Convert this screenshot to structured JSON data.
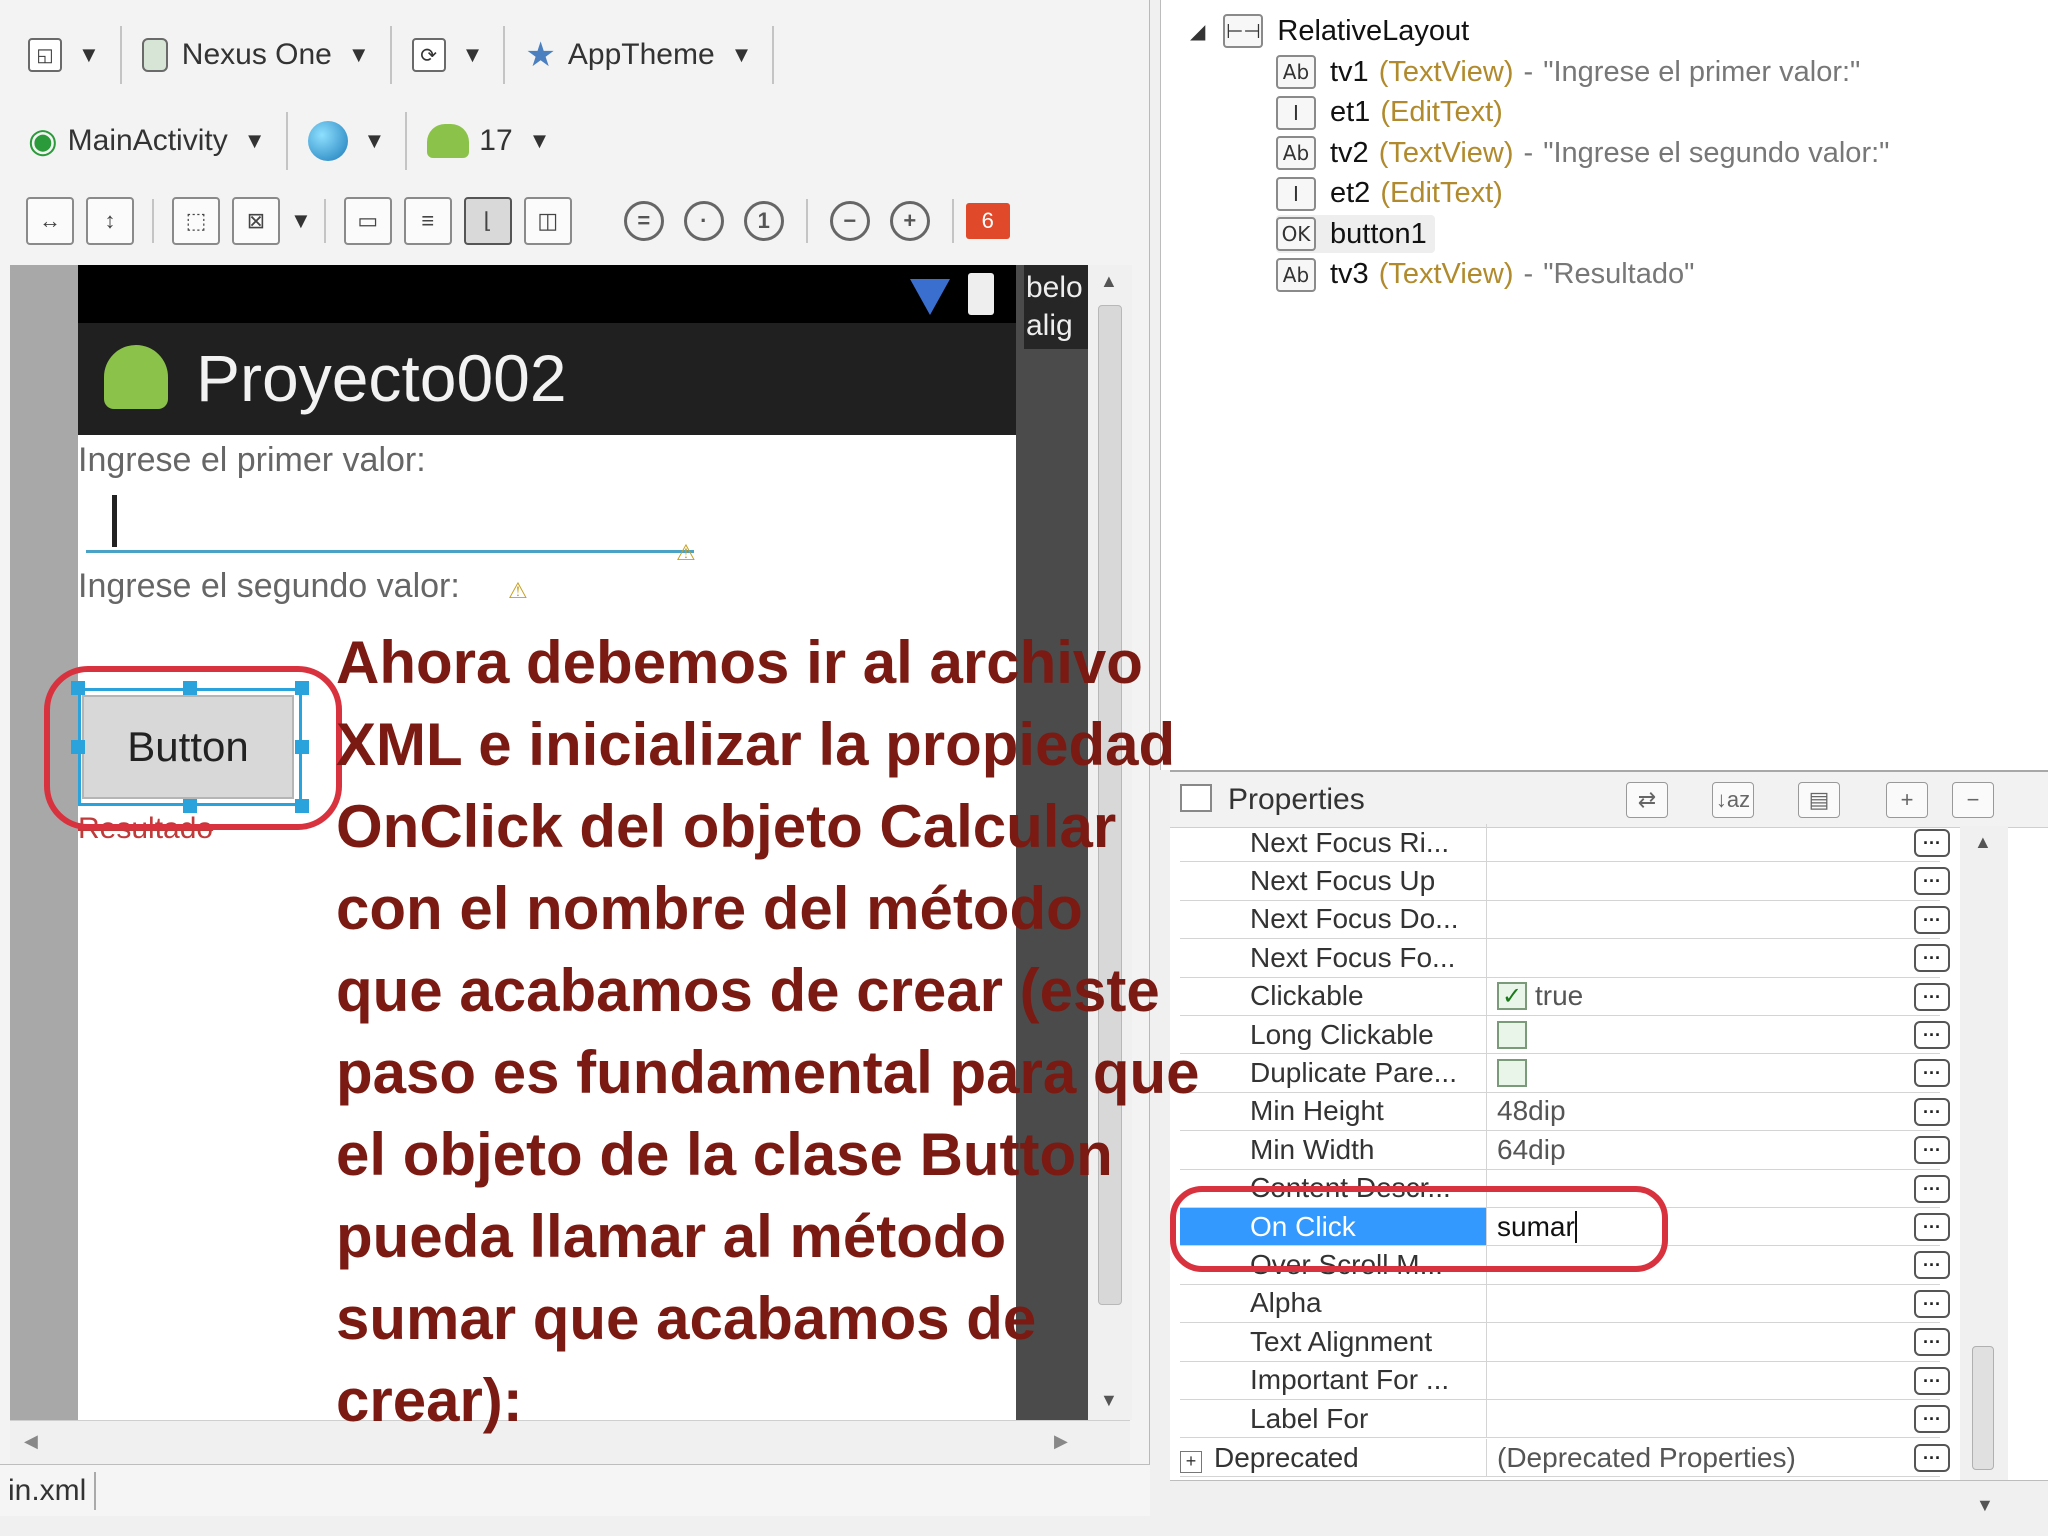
{
  "toolbar": {
    "device": "Nexus One",
    "theme": "AppTheme",
    "activity": "MainActivity",
    "api_level": "17",
    "error_badge": "6"
  },
  "preview": {
    "app_title": "Proyecto002",
    "tv1_text": "Ingrese el primer valor:",
    "tv2_text": "Ingrese el segundo valor:",
    "button_text": "Button",
    "tv3_text": "Resultado",
    "tooltip_line1": "belo",
    "tooltip_line2": "alig",
    "tab_label": "in.xml"
  },
  "outline": {
    "root": "RelativeLayout",
    "items": [
      {
        "name": "tv1",
        "type": "(TextView)",
        "dash": "-",
        "value": "\"Ingrese el primer valor:\"",
        "icon": "Ab"
      },
      {
        "name": "et1",
        "type": "(EditText)",
        "dash": "",
        "value": "",
        "icon": "I"
      },
      {
        "name": "tv2",
        "type": "(TextView)",
        "dash": "-",
        "value": "\"Ingrese el segundo valor:\"",
        "icon": "Ab"
      },
      {
        "name": "et2",
        "type": "(EditText)",
        "dash": "",
        "value": "",
        "icon": "I"
      },
      {
        "name": "button1",
        "type": "",
        "dash": "",
        "value": "",
        "icon": "OK"
      },
      {
        "name": "tv3",
        "type": "(TextView)",
        "dash": "-",
        "value": "\"Resultado\"",
        "icon": "Ab"
      }
    ]
  },
  "properties": {
    "title": "Properties",
    "rows": [
      {
        "name": "Next Focus Ri...",
        "value": ""
      },
      {
        "name": "Next Focus Up",
        "value": ""
      },
      {
        "name": "Next Focus Do...",
        "value": ""
      },
      {
        "name": "Next Focus Fo...",
        "value": ""
      },
      {
        "name": "Clickable",
        "value": "true"
      },
      {
        "name": "Long Clickable",
        "value": ""
      },
      {
        "name": "Duplicate Pare...",
        "value": ""
      },
      {
        "name": "Min Height",
        "value": "48dip"
      },
      {
        "name": "Min Width",
        "value": "64dip"
      },
      {
        "name": "Content Descr...",
        "value": ""
      },
      {
        "name": "On Click",
        "value": "sumar"
      },
      {
        "name": "Over Scroll M...",
        "value": ""
      },
      {
        "name": "Alpha",
        "value": ""
      },
      {
        "name": "Text Alignment",
        "value": ""
      },
      {
        "name": "Important For ...",
        "value": ""
      },
      {
        "name": "Label For",
        "value": ""
      }
    ],
    "deprecated_name": "Deprecated",
    "deprecated_value": "(Deprecated Properties)"
  },
  "caption": {
    "lines": [
      "Ahora debemos ir al archivo",
      "XML e inicializar la propiedad",
      "OnClick del objeto Calcular",
      "con el nombre del método",
      "que acabamos de crear (este",
      "paso es fundamental para que",
      "el objeto de la clase Button",
      "pueda llamar al método",
      "sumar que acabamos de",
      "crear):"
    ]
  },
  "colors": {
    "caption": "#7a1a12",
    "highlight_oval": "#d8323e",
    "selection": "#3399ff",
    "edit_underline": "#4aa3c7"
  }
}
